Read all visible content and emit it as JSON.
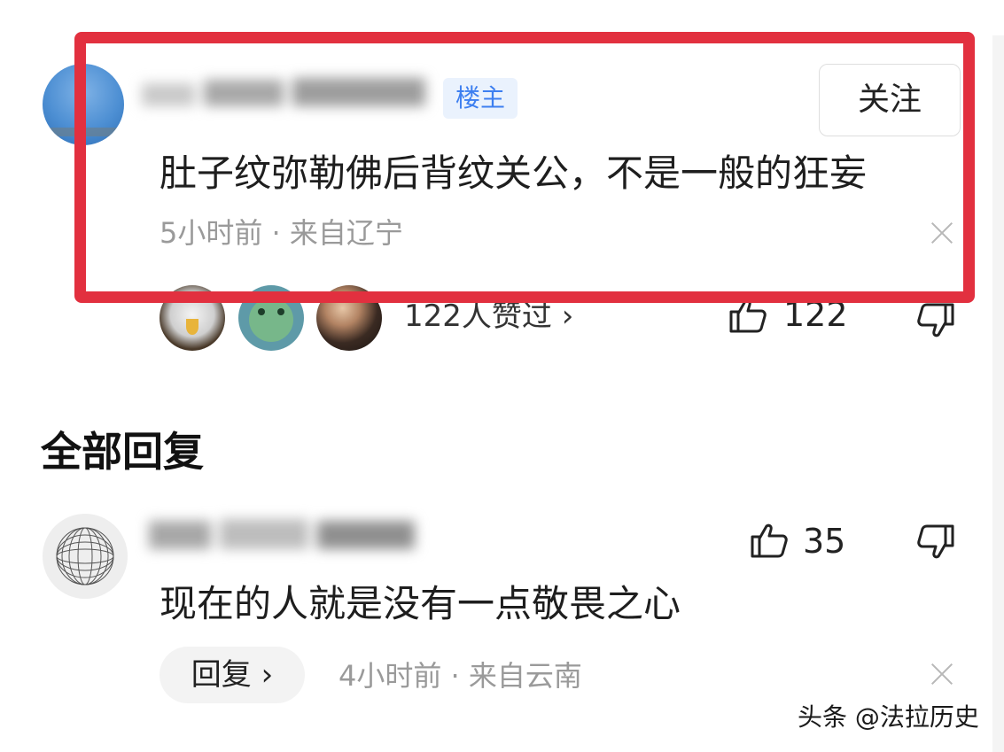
{
  "comment": {
    "author_tag": "楼主",
    "follow_label": "关注",
    "text": "肚子纹弥勒佛后背纹关公，不是一般的狂妄",
    "time": "5小时前",
    "location": "来自辽宁",
    "likers_label": "122人赞过 ›",
    "like_count": "122"
  },
  "replies_section": {
    "title": "全部回复"
  },
  "reply": {
    "text": "现在的人就是没有一点敬畏之心",
    "like_count": "35",
    "reply_button": "回复 ›",
    "time": "4小时前",
    "location": "来自云南"
  },
  "watermark": "头条 @法拉历史",
  "colors": {
    "highlight_box": "#e2303f",
    "tag_bg": "#eaf2fd",
    "tag_text": "#3d7ff0"
  },
  "icons": [
    "thumbs-up-icon",
    "thumbs-down-icon",
    "close-icon",
    "chevron-right-icon"
  ]
}
